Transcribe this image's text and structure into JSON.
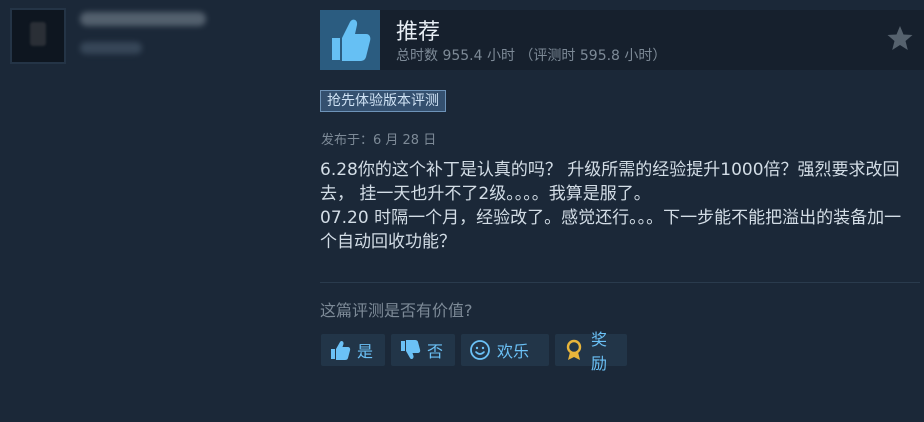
{
  "review": {
    "verdict": "推荐",
    "hours_text": "总时数 955.4 小时  （评测时 595.8 小时）",
    "early_access_badge": "抢先体验版本评测",
    "posted_date": "发布于：6 月 28 日",
    "body_paragraphs": [
      "6.28你的这个补丁是认真的吗？ 升级所需的经验提升1000倍？强烈要求改回去， 挂一天也升不了2级。。。。我算是服了。",
      "07.20 时隔一个月，经验改了。感觉还行。。。下一步能不能把溢出的装备加一个自动回收功能？"
    ],
    "helpful_question": "这篇评测是否有价值?"
  },
  "votes": {
    "yes_label": "是",
    "no_label": "否",
    "funny_label": "欢乐",
    "award_label": "奖励"
  },
  "icons": {
    "recommend": "thumbs-up-icon",
    "star": "star-icon",
    "yes": "thumbs-up-icon",
    "no": "thumbs-down-icon",
    "funny": "smile-icon",
    "award": "award-icon"
  },
  "colors": {
    "background": "#1b2838",
    "header_bg": "#16202d",
    "thumb_bg": "#2b5c80",
    "button_text": "#6bc1f6",
    "button_bg": "#223548"
  }
}
